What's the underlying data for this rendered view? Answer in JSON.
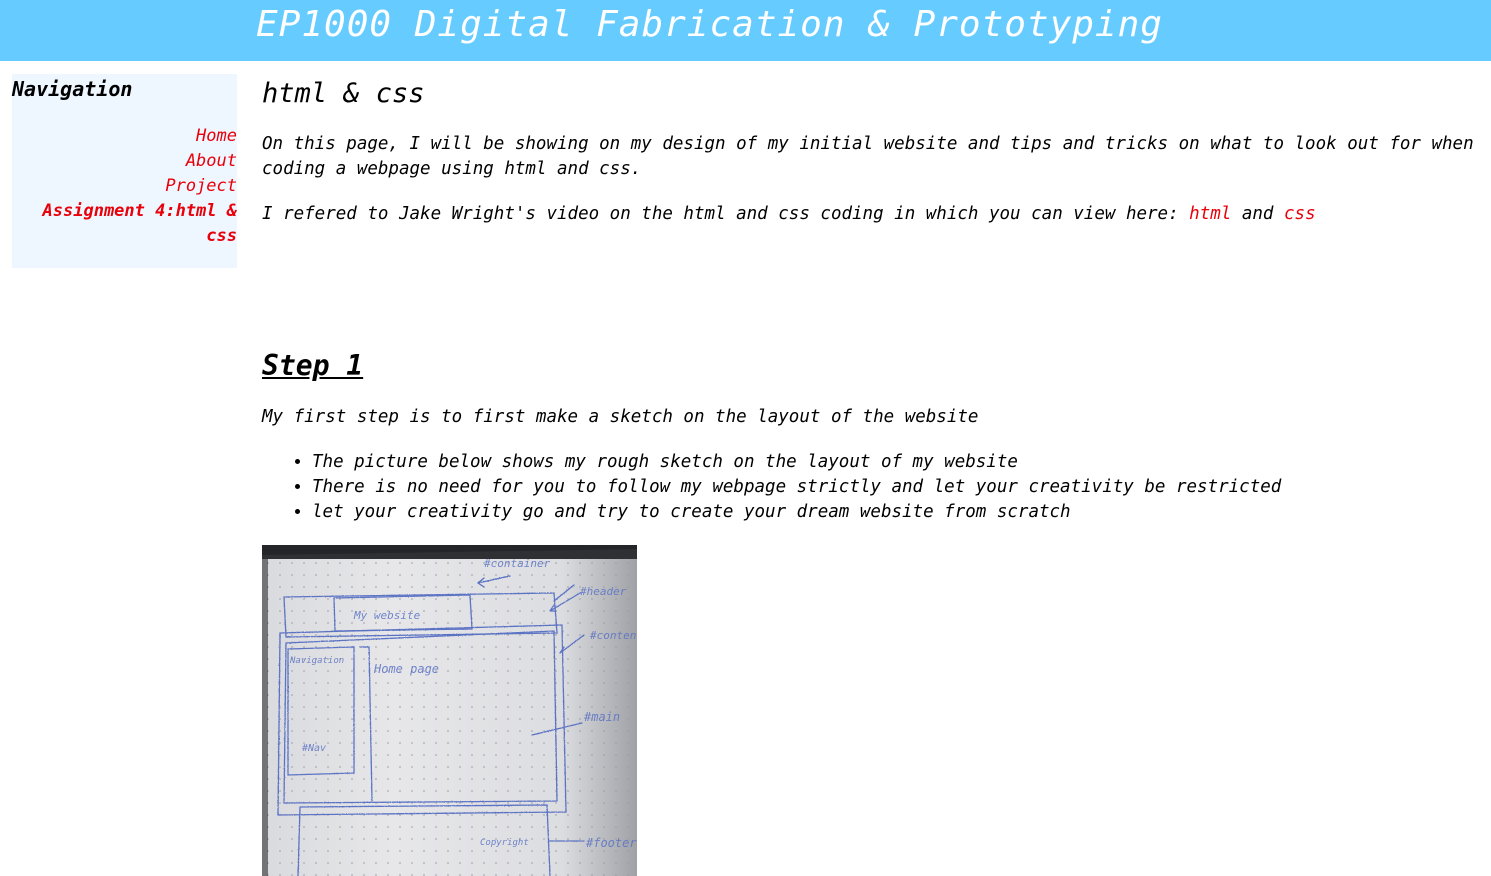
{
  "header": {
    "title": "EP1000 Digital Fabrication & Prototyping",
    "bg_color": "#66ccff"
  },
  "navigation": {
    "title": "Navigation",
    "items": [
      {
        "label": "Home"
      },
      {
        "label": "About"
      },
      {
        "label": "Project"
      },
      {
        "label": "Assignment 4:html & css",
        "active": true
      }
    ],
    "link_color": "#e8000a",
    "bg_color": "#eef7ff"
  },
  "main": {
    "heading": "html & css",
    "intro": "On this page, I will be showing on my design of my initial website and tips and tricks on what to look out for when coding a webpage using html and css.",
    "reference": {
      "text": "I refered to Jake Wright's video on the html and css coding in which you can view here: ",
      "link1": "html",
      "joiner": " and ",
      "link2": "css"
    },
    "step1": {
      "heading": "Step 1",
      "description": "My first step is to first make a sketch on the layout of the website",
      "bullets": [
        "The picture below shows my rough sketch on the layout of my website",
        "There is no need for you to follow my webpage strictly and let your creativity be restricted",
        "let your creativity go and try to create your dream website from scratch"
      ],
      "sketch": {
        "labels": {
          "container": "#container",
          "header": "#header",
          "my_website": "My website",
          "content": "#content",
          "navigation": "Navigation",
          "home_page": "Home page",
          "nav": "#Nav",
          "main": "#main",
          "copyright": "Copyright",
          "footer": "#footer"
        }
      }
    }
  }
}
